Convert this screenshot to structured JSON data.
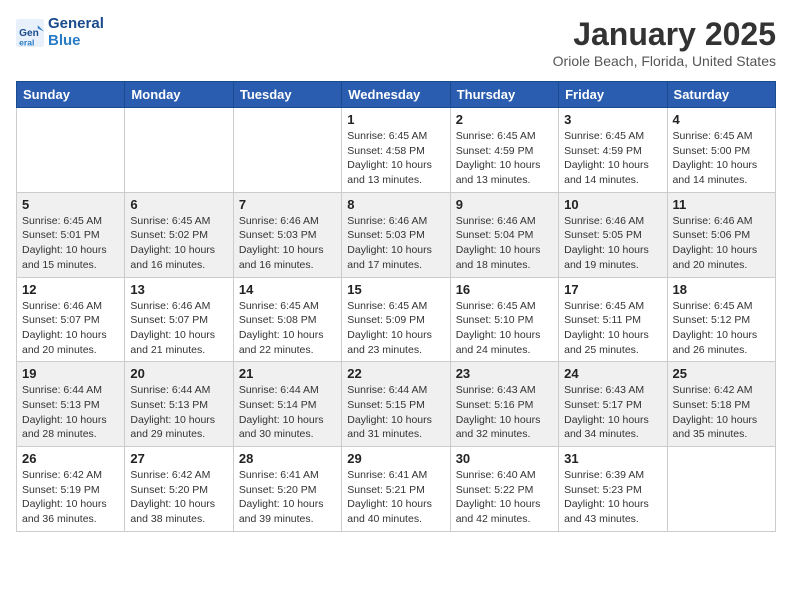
{
  "logo": {
    "line1": "General",
    "line2": "Blue"
  },
  "header": {
    "title": "January 2025",
    "location": "Oriole Beach, Florida, United States"
  },
  "weekdays": [
    "Sunday",
    "Monday",
    "Tuesday",
    "Wednesday",
    "Thursday",
    "Friday",
    "Saturday"
  ],
  "weeks": [
    [
      {
        "day": "",
        "info": ""
      },
      {
        "day": "",
        "info": ""
      },
      {
        "day": "",
        "info": ""
      },
      {
        "day": "1",
        "info": "Sunrise: 6:45 AM\nSunset: 4:58 PM\nDaylight: 10 hours\nand 13 minutes."
      },
      {
        "day": "2",
        "info": "Sunrise: 6:45 AM\nSunset: 4:59 PM\nDaylight: 10 hours\nand 13 minutes."
      },
      {
        "day": "3",
        "info": "Sunrise: 6:45 AM\nSunset: 4:59 PM\nDaylight: 10 hours\nand 14 minutes."
      },
      {
        "day": "4",
        "info": "Sunrise: 6:45 AM\nSunset: 5:00 PM\nDaylight: 10 hours\nand 14 minutes."
      }
    ],
    [
      {
        "day": "5",
        "info": "Sunrise: 6:45 AM\nSunset: 5:01 PM\nDaylight: 10 hours\nand 15 minutes."
      },
      {
        "day": "6",
        "info": "Sunrise: 6:45 AM\nSunset: 5:02 PM\nDaylight: 10 hours\nand 16 minutes."
      },
      {
        "day": "7",
        "info": "Sunrise: 6:46 AM\nSunset: 5:03 PM\nDaylight: 10 hours\nand 16 minutes."
      },
      {
        "day": "8",
        "info": "Sunrise: 6:46 AM\nSunset: 5:03 PM\nDaylight: 10 hours\nand 17 minutes."
      },
      {
        "day": "9",
        "info": "Sunrise: 6:46 AM\nSunset: 5:04 PM\nDaylight: 10 hours\nand 18 minutes."
      },
      {
        "day": "10",
        "info": "Sunrise: 6:46 AM\nSunset: 5:05 PM\nDaylight: 10 hours\nand 19 minutes."
      },
      {
        "day": "11",
        "info": "Sunrise: 6:46 AM\nSunset: 5:06 PM\nDaylight: 10 hours\nand 20 minutes."
      }
    ],
    [
      {
        "day": "12",
        "info": "Sunrise: 6:46 AM\nSunset: 5:07 PM\nDaylight: 10 hours\nand 20 minutes."
      },
      {
        "day": "13",
        "info": "Sunrise: 6:46 AM\nSunset: 5:07 PM\nDaylight: 10 hours\nand 21 minutes."
      },
      {
        "day": "14",
        "info": "Sunrise: 6:45 AM\nSunset: 5:08 PM\nDaylight: 10 hours\nand 22 minutes."
      },
      {
        "day": "15",
        "info": "Sunrise: 6:45 AM\nSunset: 5:09 PM\nDaylight: 10 hours\nand 23 minutes."
      },
      {
        "day": "16",
        "info": "Sunrise: 6:45 AM\nSunset: 5:10 PM\nDaylight: 10 hours\nand 24 minutes."
      },
      {
        "day": "17",
        "info": "Sunrise: 6:45 AM\nSunset: 5:11 PM\nDaylight: 10 hours\nand 25 minutes."
      },
      {
        "day": "18",
        "info": "Sunrise: 6:45 AM\nSunset: 5:12 PM\nDaylight: 10 hours\nand 26 minutes."
      }
    ],
    [
      {
        "day": "19",
        "info": "Sunrise: 6:44 AM\nSunset: 5:13 PM\nDaylight: 10 hours\nand 28 minutes."
      },
      {
        "day": "20",
        "info": "Sunrise: 6:44 AM\nSunset: 5:13 PM\nDaylight: 10 hours\nand 29 minutes."
      },
      {
        "day": "21",
        "info": "Sunrise: 6:44 AM\nSunset: 5:14 PM\nDaylight: 10 hours\nand 30 minutes."
      },
      {
        "day": "22",
        "info": "Sunrise: 6:44 AM\nSunset: 5:15 PM\nDaylight: 10 hours\nand 31 minutes."
      },
      {
        "day": "23",
        "info": "Sunrise: 6:43 AM\nSunset: 5:16 PM\nDaylight: 10 hours\nand 32 minutes."
      },
      {
        "day": "24",
        "info": "Sunrise: 6:43 AM\nSunset: 5:17 PM\nDaylight: 10 hours\nand 34 minutes."
      },
      {
        "day": "25",
        "info": "Sunrise: 6:42 AM\nSunset: 5:18 PM\nDaylight: 10 hours\nand 35 minutes."
      }
    ],
    [
      {
        "day": "26",
        "info": "Sunrise: 6:42 AM\nSunset: 5:19 PM\nDaylight: 10 hours\nand 36 minutes."
      },
      {
        "day": "27",
        "info": "Sunrise: 6:42 AM\nSunset: 5:20 PM\nDaylight: 10 hours\nand 38 minutes."
      },
      {
        "day": "28",
        "info": "Sunrise: 6:41 AM\nSunset: 5:20 PM\nDaylight: 10 hours\nand 39 minutes."
      },
      {
        "day": "29",
        "info": "Sunrise: 6:41 AM\nSunset: 5:21 PM\nDaylight: 10 hours\nand 40 minutes."
      },
      {
        "day": "30",
        "info": "Sunrise: 6:40 AM\nSunset: 5:22 PM\nDaylight: 10 hours\nand 42 minutes."
      },
      {
        "day": "31",
        "info": "Sunrise: 6:39 AM\nSunset: 5:23 PM\nDaylight: 10 hours\nand 43 minutes."
      },
      {
        "day": "",
        "info": ""
      }
    ]
  ]
}
